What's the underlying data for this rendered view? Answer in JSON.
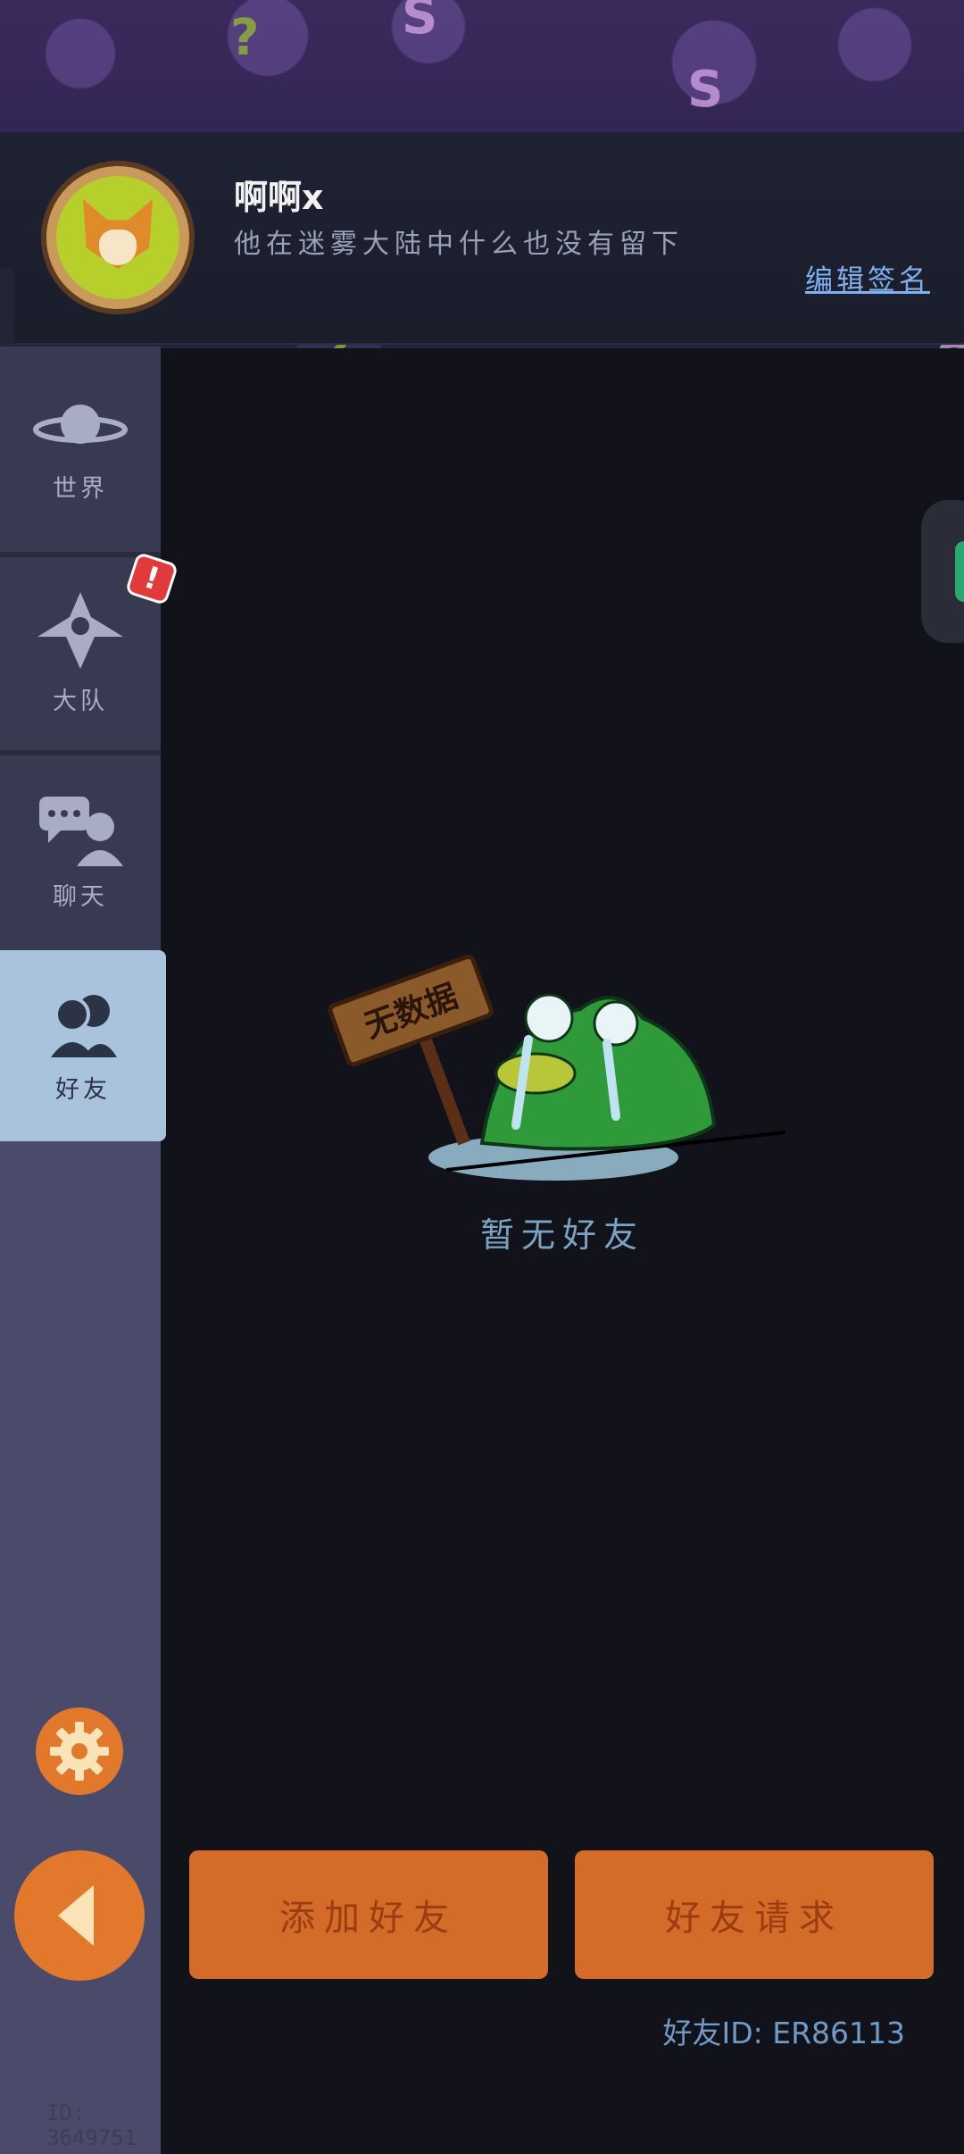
{
  "profile": {
    "username": "啊啊x",
    "signature": "他在迷雾大陆中什么也没有留下",
    "edit_signature_label": "编辑签名"
  },
  "sidebar": {
    "items": [
      {
        "label": "世界",
        "icon": "planet-icon"
      },
      {
        "label": "大队",
        "icon": "team-crest-icon"
      },
      {
        "label": "聊天",
        "icon": "chat-bubbles-icon"
      },
      {
        "label": "好友",
        "icon": "friends-icon"
      }
    ],
    "active": "好友",
    "team_badge": "!"
  },
  "empty_state": {
    "sign_text": "无数据",
    "message": "暂无好友"
  },
  "actions": {
    "add_friend_label": "添加好友",
    "friend_requests_label": "好友请求"
  },
  "friend_id": "好友ID: ER86113",
  "user_id": "ID: 3649751",
  "colors": {
    "accent_orange": "#d46b28",
    "active_tab": "#a9c3dc",
    "link_blue": "#7fb0ef",
    "frog_green": "#2f9a3a"
  }
}
